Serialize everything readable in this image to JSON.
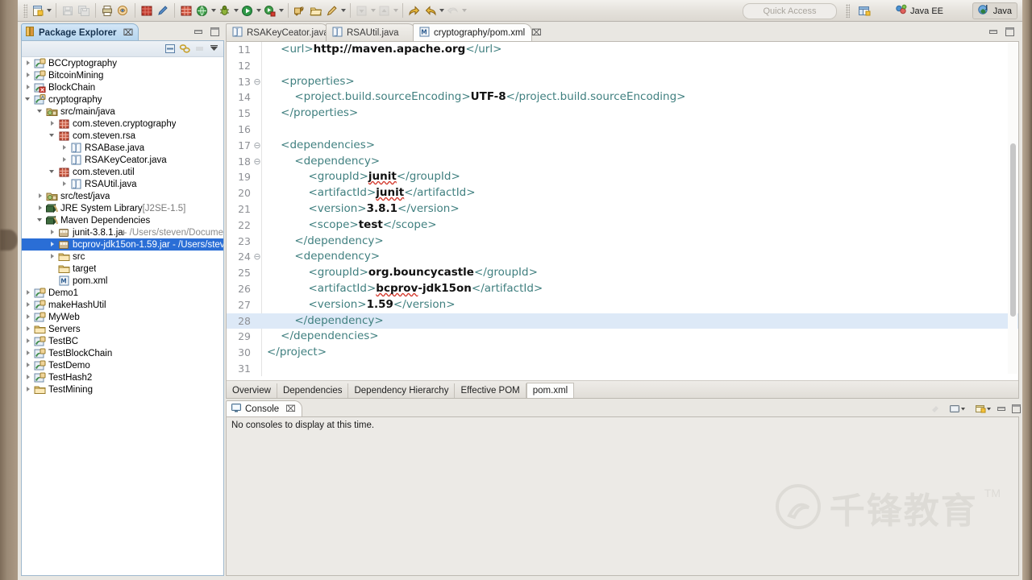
{
  "toolbar": {
    "items": [
      {
        "name": "new-wizard-button",
        "icon": "new-file-icon",
        "caret": true,
        "dim": false
      },
      {
        "name": "save-button",
        "icon": "save-icon",
        "caret": false,
        "dim": true
      },
      {
        "name": "save-all-button",
        "icon": "save-all-icon",
        "caret": false,
        "dim": true
      },
      {
        "name": "print-button",
        "icon": "print-icon",
        "caret": false,
        "dim": false
      },
      {
        "name": "open-type-button",
        "icon": "open-type-icon",
        "caret": false,
        "dim": false
      },
      {
        "name": "new-java-class-button",
        "icon": "java-class-icon",
        "caret": false,
        "dim": false
      },
      {
        "name": "toggle-markoccurrences-button",
        "icon": "pencil-icon",
        "caret": false,
        "dim": false
      },
      {
        "name": "new-package-button",
        "icon": "package-icon",
        "caret": false,
        "dim": false
      },
      {
        "name": "search-button",
        "icon": "search-globe-icon",
        "caret": true,
        "dim": false
      },
      {
        "name": "debug-button",
        "icon": "debug-bug-icon",
        "caret": true,
        "dim": false
      },
      {
        "name": "run-button",
        "icon": "run-play-icon",
        "caret": true,
        "dim": false
      },
      {
        "name": "coverage-button",
        "icon": "coverage-icon",
        "caret": true,
        "dim": false
      },
      {
        "name": "external-tools-button",
        "icon": "external-tools-icon",
        "caret": false,
        "dim": false
      },
      {
        "name": "open-folder-button",
        "icon": "open-folder-icon",
        "caret": false,
        "dim": false
      },
      {
        "name": "new-editor-button",
        "icon": "edit-pencil-icon",
        "caret": true,
        "dim": false
      },
      {
        "name": "previous-annotation-button",
        "icon": "prev-annotation-icon",
        "caret": true,
        "dim": true
      },
      {
        "name": "next-annotation-button",
        "icon": "next-annotation-icon",
        "caret": true,
        "dim": true
      },
      {
        "name": "back-button",
        "icon": "back-arrow-icon",
        "caret": false,
        "dim": false
      },
      {
        "name": "forward-button",
        "icon": "forward-arrow-icon",
        "caret": true,
        "dim": false
      },
      {
        "name": "undo-button",
        "icon": "undo-arrow-icon",
        "caret": true,
        "dim": true
      }
    ],
    "quick_access_placeholder": "Quick Access",
    "perspective_open_label": "",
    "perspectives": [
      {
        "name": "perspective-java-ee",
        "label": "Java EE",
        "icon": "java-ee-icon",
        "active": false
      },
      {
        "name": "perspective-java",
        "label": "Java",
        "icon": "java-icon",
        "active": true
      }
    ]
  },
  "package_explorer": {
    "title": "Package Explorer",
    "close_glyph": "⌧",
    "view_tools": [
      "collapse-all-icon",
      "link-with-editor-icon",
      "focus-icon",
      "view-menu-icon"
    ],
    "tree": [
      {
        "indent": 0,
        "arrow": "r",
        "icon": "java-project",
        "label": "BCCryptography",
        "selected": false
      },
      {
        "indent": 0,
        "arrow": "r",
        "icon": "java-project",
        "label": "BitcoinMining",
        "selected": false
      },
      {
        "indent": 0,
        "arrow": "r",
        "icon": "java-project-error",
        "label": "BlockChain",
        "selected": false
      },
      {
        "indent": 0,
        "arrow": "d",
        "icon": "maven-project",
        "label": "cryptography",
        "selected": false
      },
      {
        "indent": 1,
        "arrow": "d",
        "icon": "source-folder",
        "label": "src/main/java",
        "selected": false
      },
      {
        "indent": 2,
        "arrow": "r",
        "icon": "package",
        "label": "com.steven.cryptography",
        "selected": false
      },
      {
        "indent": 2,
        "arrow": "d",
        "icon": "package",
        "label": "com.steven.rsa",
        "selected": false
      },
      {
        "indent": 3,
        "arrow": "r",
        "icon": "java-file",
        "label": "RSABase.java",
        "selected": false
      },
      {
        "indent": 3,
        "arrow": "r",
        "icon": "java-file",
        "label": "RSAKeyCeator.java",
        "selected": false
      },
      {
        "indent": 2,
        "arrow": "d",
        "icon": "package",
        "label": "com.steven.util",
        "selected": false
      },
      {
        "indent": 3,
        "arrow": "r",
        "icon": "java-file",
        "label": "RSAUtil.java",
        "selected": false
      },
      {
        "indent": 1,
        "arrow": "r",
        "icon": "source-folder",
        "label": "src/test/java",
        "selected": false
      },
      {
        "indent": 1,
        "arrow": "r",
        "icon": "library",
        "label": "JRE System Library",
        "sub": "[J2SE-1.5]",
        "subtype": "jre",
        "selected": false
      },
      {
        "indent": 1,
        "arrow": "d",
        "icon": "library",
        "label": "Maven Dependencies",
        "selected": false
      },
      {
        "indent": 2,
        "arrow": "r",
        "icon": "jar",
        "label": "junit-3.8.1.jar",
        "sub": "- /Users/steven/Docume",
        "selected": false
      },
      {
        "indent": 2,
        "arrow": "r",
        "icon": "jar",
        "label": "bcprov-jdk15on-1.59.jar - /Users/stev",
        "selected": true
      },
      {
        "indent": 2,
        "arrow": "r",
        "icon": "folder",
        "label": "src",
        "selected": false
      },
      {
        "indent": 2,
        "arrow": "none",
        "icon": "folder",
        "label": "target",
        "selected": false
      },
      {
        "indent": 2,
        "arrow": "none",
        "icon": "maven-file",
        "label": "pom.xml",
        "selected": false
      },
      {
        "indent": 0,
        "arrow": "r",
        "icon": "java-project",
        "label": "Demo1",
        "selected": false
      },
      {
        "indent": 0,
        "arrow": "r",
        "icon": "java-project",
        "label": "makeHashUtil",
        "selected": false
      },
      {
        "indent": 0,
        "arrow": "r",
        "icon": "java-project",
        "label": "MyWeb",
        "selected": false
      },
      {
        "indent": 0,
        "arrow": "r",
        "icon": "folder",
        "label": "Servers",
        "selected": false
      },
      {
        "indent": 0,
        "arrow": "r",
        "icon": "java-project",
        "label": "TestBC",
        "selected": false
      },
      {
        "indent": 0,
        "arrow": "r",
        "icon": "java-project",
        "label": "TestBlockChain",
        "selected": false
      },
      {
        "indent": 0,
        "arrow": "r",
        "icon": "java-project",
        "label": "TestDemo",
        "selected": false
      },
      {
        "indent": 0,
        "arrow": "r",
        "icon": "java-project",
        "label": "TestHash2",
        "selected": false
      },
      {
        "indent": 0,
        "arrow": "r",
        "icon": "folder",
        "label": "TestMining",
        "selected": false
      }
    ]
  },
  "editor": {
    "tabs": [
      {
        "label": "RSAKeyCeator.java",
        "icon": "java-file-icon",
        "active": false,
        "closable": false
      },
      {
        "label": "RSAUtil.java",
        "icon": "java-file-icon",
        "active": false,
        "closable": false
      },
      {
        "label": "cryptography/pom.xml",
        "icon": "maven-file-icon",
        "active": true,
        "closable": true,
        "close_glyph": "⌧"
      }
    ],
    "lines": [
      {
        "num": "11",
        "fold": "",
        "indent": 1,
        "highlight": false,
        "parts": [
          {
            "t": "tag",
            "s": "<url>"
          },
          {
            "t": "val",
            "s": "http://maven.apache.org"
          },
          {
            "t": "tag",
            "s": "</url>"
          }
        ]
      },
      {
        "num": "12",
        "fold": "",
        "indent": 0,
        "highlight": false,
        "parts": []
      },
      {
        "num": "13",
        "fold": "minus",
        "indent": 1,
        "highlight": false,
        "parts": [
          {
            "t": "tag",
            "s": "<properties>"
          }
        ]
      },
      {
        "num": "14",
        "fold": "",
        "indent": 2,
        "highlight": false,
        "parts": [
          {
            "t": "tag",
            "s": "<project.build.sourceEncoding>"
          },
          {
            "t": "val",
            "s": "UTF-8"
          },
          {
            "t": "tag",
            "s": "</project.build.sourceEncoding>"
          }
        ]
      },
      {
        "num": "15",
        "fold": "",
        "indent": 1,
        "highlight": false,
        "parts": [
          {
            "t": "tag",
            "s": "</properties>"
          }
        ]
      },
      {
        "num": "16",
        "fold": "",
        "indent": 0,
        "highlight": false,
        "parts": []
      },
      {
        "num": "17",
        "fold": "minus",
        "indent": 1,
        "highlight": false,
        "parts": [
          {
            "t": "tag",
            "s": "<dependencies>"
          }
        ]
      },
      {
        "num": "18",
        "fold": "minus",
        "indent": 2,
        "highlight": false,
        "parts": [
          {
            "t": "tag",
            "s": "<dependency>"
          }
        ]
      },
      {
        "num": "19",
        "fold": "",
        "indent": 3,
        "highlight": false,
        "parts": [
          {
            "t": "tag",
            "s": "<groupId>"
          },
          {
            "t": "sq",
            "s": "junit"
          },
          {
            "t": "tag",
            "s": "</groupId>"
          }
        ]
      },
      {
        "num": "20",
        "fold": "",
        "indent": 3,
        "highlight": false,
        "parts": [
          {
            "t": "tag",
            "s": "<artifactId>"
          },
          {
            "t": "sq",
            "s": "junit"
          },
          {
            "t": "tag",
            "s": "</artifactId>"
          }
        ]
      },
      {
        "num": "21",
        "fold": "",
        "indent": 3,
        "highlight": false,
        "parts": [
          {
            "t": "tag",
            "s": "<version>"
          },
          {
            "t": "val",
            "s": "3.8.1"
          },
          {
            "t": "tag",
            "s": "</version>"
          }
        ]
      },
      {
        "num": "22",
        "fold": "",
        "indent": 3,
        "highlight": false,
        "parts": [
          {
            "t": "tag",
            "s": "<scope>"
          },
          {
            "t": "val",
            "s": "test"
          },
          {
            "t": "tag",
            "s": "</scope>"
          }
        ]
      },
      {
        "num": "23",
        "fold": "",
        "indent": 2,
        "highlight": false,
        "parts": [
          {
            "t": "tag",
            "s": "</dependency>"
          }
        ]
      },
      {
        "num": "24",
        "fold": "minus",
        "indent": 2,
        "highlight": false,
        "parts": [
          {
            "t": "tag",
            "s": "<dependency>"
          }
        ]
      },
      {
        "num": "25",
        "fold": "",
        "indent": 3,
        "highlight": false,
        "parts": [
          {
            "t": "tag",
            "s": "<groupId>"
          },
          {
            "t": "val",
            "s": "org.bouncycastle"
          },
          {
            "t": "tag",
            "s": "</groupId>"
          }
        ]
      },
      {
        "num": "26",
        "fold": "",
        "indent": 3,
        "highlight": false,
        "parts": [
          {
            "t": "tag",
            "s": "<artifactId>"
          },
          {
            "t": "sq",
            "s": "bcprov"
          },
          {
            "t": "val",
            "s": "-jdk15on"
          },
          {
            "t": "tag",
            "s": "</artifactId>"
          }
        ]
      },
      {
        "num": "27",
        "fold": "",
        "indent": 3,
        "highlight": false,
        "parts": [
          {
            "t": "tag",
            "s": "<version>"
          },
          {
            "t": "val",
            "s": "1.59"
          },
          {
            "t": "tag",
            "s": "</version>"
          }
        ]
      },
      {
        "num": "28",
        "fold": "",
        "indent": 2,
        "highlight": true,
        "parts": [
          {
            "t": "tag",
            "s": "</dependency>"
          }
        ]
      },
      {
        "num": "29",
        "fold": "",
        "indent": 1,
        "highlight": false,
        "parts": [
          {
            "t": "tag",
            "s": "</dependencies>"
          }
        ]
      },
      {
        "num": "30",
        "fold": "",
        "indent": 0,
        "highlight": false,
        "parts": [
          {
            "t": "tag",
            "s": "</project>"
          }
        ]
      },
      {
        "num": "31",
        "fold": "",
        "indent": 0,
        "highlight": false,
        "parts": []
      }
    ],
    "form_tabs": [
      {
        "label": "Overview",
        "active": false
      },
      {
        "label": "Dependencies",
        "active": false
      },
      {
        "label": "Dependency Hierarchy",
        "active": false
      },
      {
        "label": "Effective POM",
        "active": false
      },
      {
        "label": "pom.xml",
        "active": true
      }
    ]
  },
  "console": {
    "title": "Console",
    "close_glyph": "⌧",
    "message": "No consoles to display at this time.",
    "tools": [
      "pin-console-icon",
      "display-console-icon",
      "open-console-icon"
    ]
  },
  "watermark": {
    "text": "千锋教育",
    "tm": "TM"
  },
  "colors": {
    "selection_blue": "#2a6ed6",
    "tag_teal": "#3f7f7f",
    "line_highlight": "#dde9f7",
    "tab_blue": "#b4d4ee",
    "spellcheck_red": "#d43b2f"
  }
}
